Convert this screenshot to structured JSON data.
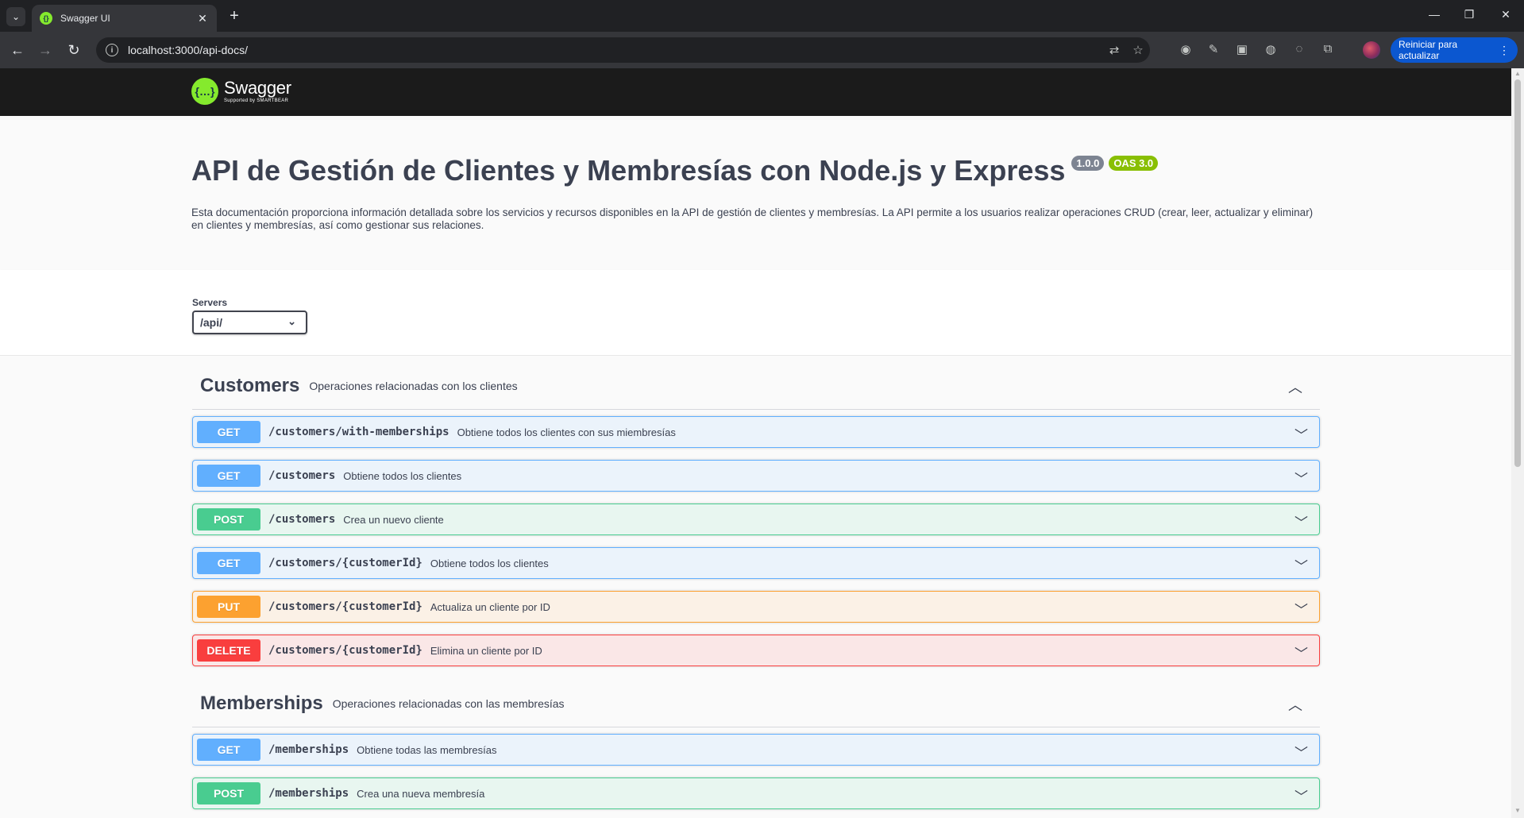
{
  "browser": {
    "tab_title": "Swagger UI",
    "url": "localhost:3000/api-docs/",
    "update_button": "Reiniciar para actualizar"
  },
  "swagger": {
    "brand": "Swagger",
    "brand_sub": "Supported by SMARTBEAR",
    "title": "API de Gestión de Clientes y Membresías con Node.js y Express",
    "version": "1.0.0",
    "oas": "OAS 3.0",
    "description": "Esta documentación proporciona información detallada sobre los servicios y recursos disponibles en la API de gestión de clientes y membresías. La API permite a los usuarios realizar operaciones CRUD (crear, leer, actualizar y eliminar) en clientes y membresías, así como gestionar sus relaciones.",
    "servers_label": "Servers",
    "server_selected": "/api/"
  },
  "tags": [
    {
      "name": "Customers",
      "description": "Operaciones relacionadas con los clientes",
      "operations": [
        {
          "method": "GET",
          "path": "/customers/with-memberships",
          "summary": "Obtiene todos los clientes con sus miembresías"
        },
        {
          "method": "GET",
          "path": "/customers",
          "summary": "Obtiene todos los clientes"
        },
        {
          "method": "POST",
          "path": "/customers",
          "summary": "Crea un nuevo cliente"
        },
        {
          "method": "GET",
          "path": "/customers/{customerId}",
          "summary": "Obtiene todos los clientes"
        },
        {
          "method": "PUT",
          "path": "/customers/{customerId}",
          "summary": "Actualiza un cliente por ID"
        },
        {
          "method": "DELETE",
          "path": "/customers/{customerId}",
          "summary": "Elimina un cliente por ID"
        }
      ]
    },
    {
      "name": "Memberships",
      "description": "Operaciones relacionadas con las membresías",
      "operations": [
        {
          "method": "GET",
          "path": "/memberships",
          "summary": "Obtiene todas las membresías"
        },
        {
          "method": "POST",
          "path": "/memberships",
          "summary": "Crea una nueva membresía"
        }
      ]
    }
  ],
  "colors": {
    "get": "#61affe",
    "post": "#49cc90",
    "put": "#fca130",
    "delete": "#f93e3e",
    "topbar": "#1b1b1b",
    "brand_green": "#85ea2d"
  }
}
